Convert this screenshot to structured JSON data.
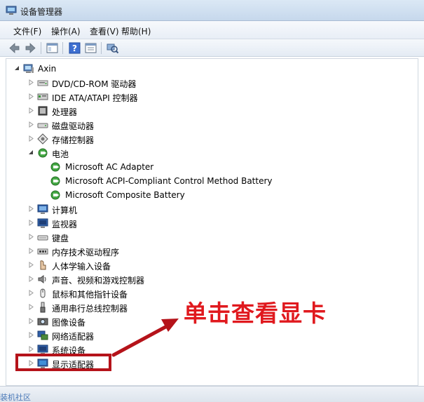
{
  "window": {
    "title": "设备管理器"
  },
  "menubar": [
    "文件(F)",
    "操作(A)",
    "查看(V)",
    "帮助(H)"
  ],
  "tree": {
    "root": "Axin",
    "categories": [
      "DVD/CD-ROM 驱动器",
      "IDE ATA/ATAPI 控制器",
      "处理器",
      "磁盘驱动器",
      "存储控制器",
      "电池",
      "计算机",
      "监视器",
      "键盘",
      "内存技术驱动程序",
      "人体学输入设备",
      "声音、视频和游戏控制器",
      "鼠标和其他指针设备",
      "通用串行总线控制器",
      "图像设备",
      "网络适配器",
      "系统设备",
      "显示适配器"
    ],
    "battery_children": [
      "Microsoft AC Adapter",
      "Microsoft ACPI-Compliant Control Method Battery",
      "Microsoft Composite Battery"
    ]
  },
  "annotation": {
    "text": "单击查看显卡",
    "color": "#e0191e"
  },
  "watermark": "装机社区"
}
